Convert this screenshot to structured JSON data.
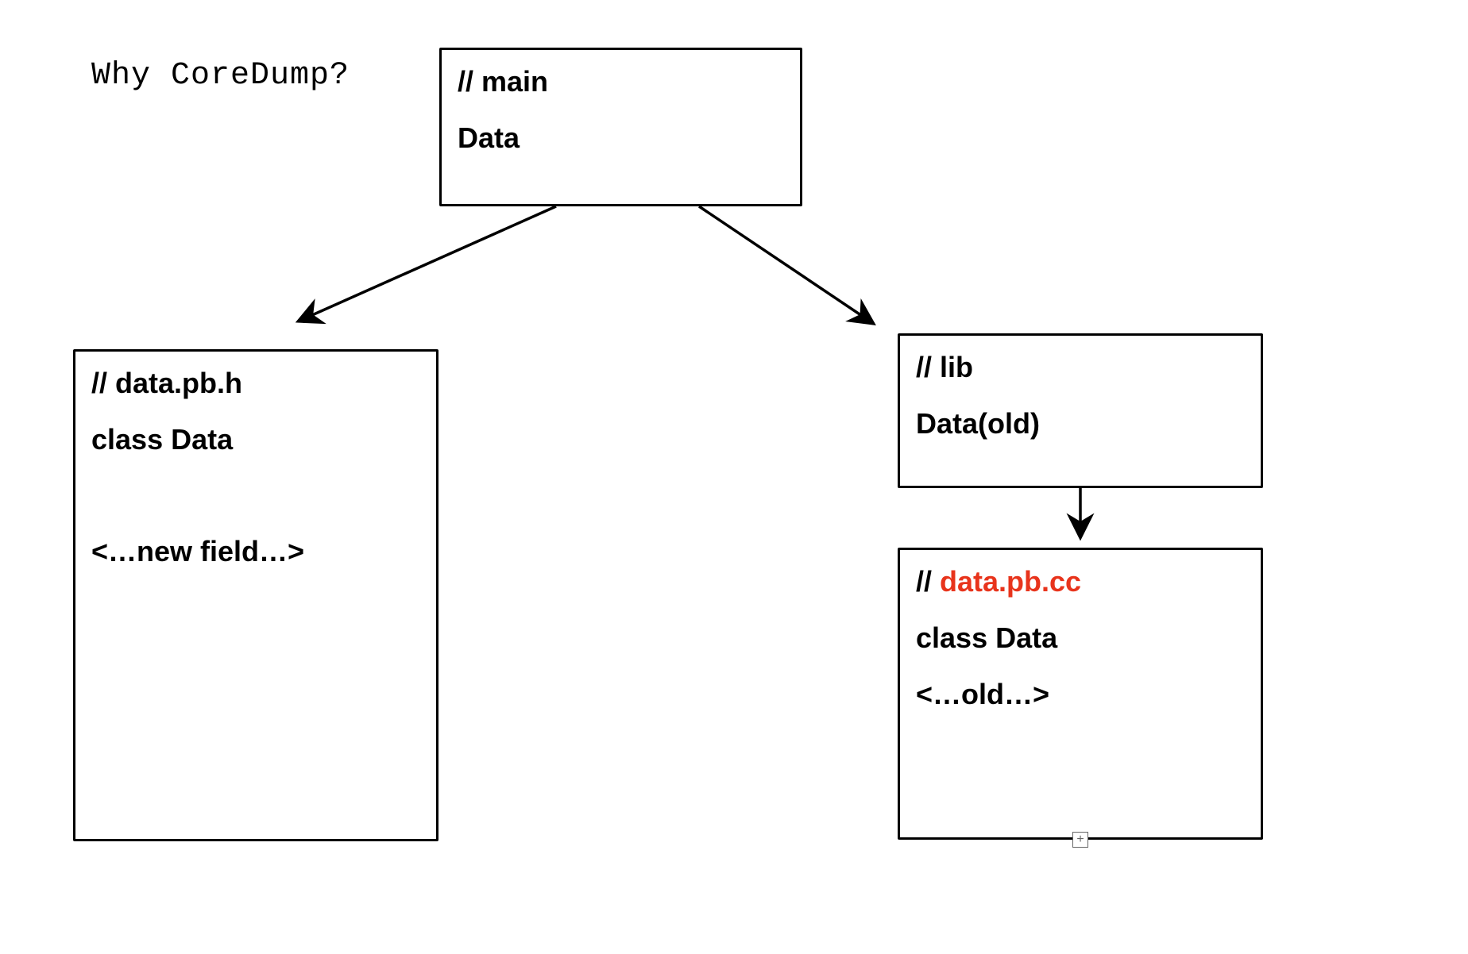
{
  "title": "Why CoreDump?",
  "boxes": {
    "main": {
      "comment": "// main",
      "body1": "Data"
    },
    "header": {
      "comment": "// data.pb.h",
      "body1": "class Data",
      "body2": "<…new field…>"
    },
    "lib": {
      "comment": "// lib",
      "body1": "Data(old)"
    },
    "impl": {
      "comment_prefix": "// ",
      "comment_file": "data.pb.cc",
      "body1": "class Data",
      "body2": "<…old…>"
    }
  },
  "colors": {
    "highlight": "#e8341c"
  }
}
